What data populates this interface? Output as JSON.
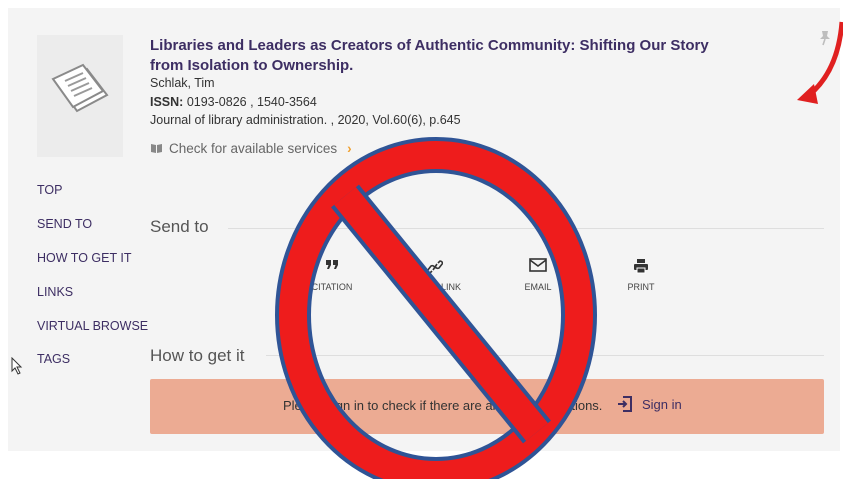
{
  "record": {
    "title": "Libraries and Leaders as Creators of Authentic Community: Shifting Our Story from Isolation to Ownership.",
    "author": "Schlak, Tim",
    "issn_label": "ISSN:",
    "issn_value": " 0193-0826 , 1540-3564",
    "journal": "Journal of library administration. , 2020, Vol.60(6), p.645",
    "check_services": "Check for available services",
    "chevron": "›"
  },
  "nav": {
    "items": [
      "TOP",
      "SEND TO",
      "HOW TO GET IT",
      "LINKS",
      "VIRTUAL BROWSE",
      "TAGS"
    ]
  },
  "send_to": {
    "heading": "Send to",
    "actions": [
      {
        "label": "CITATION",
        "icon": "quote-icon"
      },
      {
        "label": "PERMALINK",
        "icon": "link-icon"
      },
      {
        "label": "EMAIL",
        "icon": "envelope-icon"
      },
      {
        "label": "PRINT",
        "icon": "printer-icon"
      }
    ]
  },
  "how_to_get_it": {
    "heading": "How to get it",
    "message": "Please sign in to check if there are any request options.",
    "sign_in": "Sign in"
  },
  "colors": {
    "accent": "#3d2e63",
    "signin_bar": "#ecab93",
    "prohibition_red": "#ee1c1c",
    "prohibition_outline": "#2f5496",
    "arrow_red": "#e02020"
  }
}
